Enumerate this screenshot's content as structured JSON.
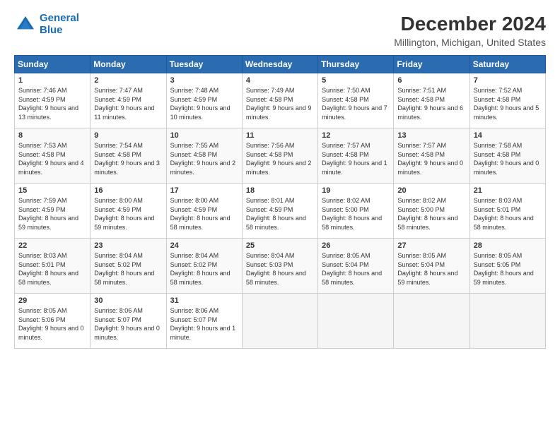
{
  "logo": {
    "line1": "General",
    "line2": "Blue"
  },
  "title": "December 2024",
  "subtitle": "Millington, Michigan, United States",
  "days_header": [
    "Sunday",
    "Monday",
    "Tuesday",
    "Wednesday",
    "Thursday",
    "Friday",
    "Saturday"
  ],
  "weeks": [
    [
      {
        "day": "1",
        "sunrise": "Sunrise: 7:46 AM",
        "sunset": "Sunset: 4:59 PM",
        "daylight": "Daylight: 9 hours and 13 minutes."
      },
      {
        "day": "2",
        "sunrise": "Sunrise: 7:47 AM",
        "sunset": "Sunset: 4:59 PM",
        "daylight": "Daylight: 9 hours and 11 minutes."
      },
      {
        "day": "3",
        "sunrise": "Sunrise: 7:48 AM",
        "sunset": "Sunset: 4:59 PM",
        "daylight": "Daylight: 9 hours and 10 minutes."
      },
      {
        "day": "4",
        "sunrise": "Sunrise: 7:49 AM",
        "sunset": "Sunset: 4:58 PM",
        "daylight": "Daylight: 9 hours and 9 minutes."
      },
      {
        "day": "5",
        "sunrise": "Sunrise: 7:50 AM",
        "sunset": "Sunset: 4:58 PM",
        "daylight": "Daylight: 9 hours and 7 minutes."
      },
      {
        "day": "6",
        "sunrise": "Sunrise: 7:51 AM",
        "sunset": "Sunset: 4:58 PM",
        "daylight": "Daylight: 9 hours and 6 minutes."
      },
      {
        "day": "7",
        "sunrise": "Sunrise: 7:52 AM",
        "sunset": "Sunset: 4:58 PM",
        "daylight": "Daylight: 9 hours and 5 minutes."
      }
    ],
    [
      {
        "day": "8",
        "sunrise": "Sunrise: 7:53 AM",
        "sunset": "Sunset: 4:58 PM",
        "daylight": "Daylight: 9 hours and 4 minutes."
      },
      {
        "day": "9",
        "sunrise": "Sunrise: 7:54 AM",
        "sunset": "Sunset: 4:58 PM",
        "daylight": "Daylight: 9 hours and 3 minutes."
      },
      {
        "day": "10",
        "sunrise": "Sunrise: 7:55 AM",
        "sunset": "Sunset: 4:58 PM",
        "daylight": "Daylight: 9 hours and 2 minutes."
      },
      {
        "day": "11",
        "sunrise": "Sunrise: 7:56 AM",
        "sunset": "Sunset: 4:58 PM",
        "daylight": "Daylight: 9 hours and 2 minutes."
      },
      {
        "day": "12",
        "sunrise": "Sunrise: 7:57 AM",
        "sunset": "Sunset: 4:58 PM",
        "daylight": "Daylight: 9 hours and 1 minute."
      },
      {
        "day": "13",
        "sunrise": "Sunrise: 7:57 AM",
        "sunset": "Sunset: 4:58 PM",
        "daylight": "Daylight: 9 hours and 0 minutes."
      },
      {
        "day": "14",
        "sunrise": "Sunrise: 7:58 AM",
        "sunset": "Sunset: 4:58 PM",
        "daylight": "Daylight: 9 hours and 0 minutes."
      }
    ],
    [
      {
        "day": "15",
        "sunrise": "Sunrise: 7:59 AM",
        "sunset": "Sunset: 4:59 PM",
        "daylight": "Daylight: 8 hours and 59 minutes."
      },
      {
        "day": "16",
        "sunrise": "Sunrise: 8:00 AM",
        "sunset": "Sunset: 4:59 PM",
        "daylight": "Daylight: 8 hours and 59 minutes."
      },
      {
        "day": "17",
        "sunrise": "Sunrise: 8:00 AM",
        "sunset": "Sunset: 4:59 PM",
        "daylight": "Daylight: 8 hours and 58 minutes."
      },
      {
        "day": "18",
        "sunrise": "Sunrise: 8:01 AM",
        "sunset": "Sunset: 4:59 PM",
        "daylight": "Daylight: 8 hours and 58 minutes."
      },
      {
        "day": "19",
        "sunrise": "Sunrise: 8:02 AM",
        "sunset": "Sunset: 5:00 PM",
        "daylight": "Daylight: 8 hours and 58 minutes."
      },
      {
        "day": "20",
        "sunrise": "Sunrise: 8:02 AM",
        "sunset": "Sunset: 5:00 PM",
        "daylight": "Daylight: 8 hours and 58 minutes."
      },
      {
        "day": "21",
        "sunrise": "Sunrise: 8:03 AM",
        "sunset": "Sunset: 5:01 PM",
        "daylight": "Daylight: 8 hours and 58 minutes."
      }
    ],
    [
      {
        "day": "22",
        "sunrise": "Sunrise: 8:03 AM",
        "sunset": "Sunset: 5:01 PM",
        "daylight": "Daylight: 8 hours and 58 minutes."
      },
      {
        "day": "23",
        "sunrise": "Sunrise: 8:04 AM",
        "sunset": "Sunset: 5:02 PM",
        "daylight": "Daylight: 8 hours and 58 minutes."
      },
      {
        "day": "24",
        "sunrise": "Sunrise: 8:04 AM",
        "sunset": "Sunset: 5:02 PM",
        "daylight": "Daylight: 8 hours and 58 minutes."
      },
      {
        "day": "25",
        "sunrise": "Sunrise: 8:04 AM",
        "sunset": "Sunset: 5:03 PM",
        "daylight": "Daylight: 8 hours and 58 minutes."
      },
      {
        "day": "26",
        "sunrise": "Sunrise: 8:05 AM",
        "sunset": "Sunset: 5:04 PM",
        "daylight": "Daylight: 8 hours and 58 minutes."
      },
      {
        "day": "27",
        "sunrise": "Sunrise: 8:05 AM",
        "sunset": "Sunset: 5:04 PM",
        "daylight": "Daylight: 8 hours and 59 minutes."
      },
      {
        "day": "28",
        "sunrise": "Sunrise: 8:05 AM",
        "sunset": "Sunset: 5:05 PM",
        "daylight": "Daylight: 8 hours and 59 minutes."
      }
    ],
    [
      {
        "day": "29",
        "sunrise": "Sunrise: 8:05 AM",
        "sunset": "Sunset: 5:06 PM",
        "daylight": "Daylight: 9 hours and 0 minutes."
      },
      {
        "day": "30",
        "sunrise": "Sunrise: 8:06 AM",
        "sunset": "Sunset: 5:07 PM",
        "daylight": "Daylight: 9 hours and 0 minutes."
      },
      {
        "day": "31",
        "sunrise": "Sunrise: 8:06 AM",
        "sunset": "Sunset: 5:07 PM",
        "daylight": "Daylight: 9 hours and 1 minute."
      },
      null,
      null,
      null,
      null
    ]
  ]
}
